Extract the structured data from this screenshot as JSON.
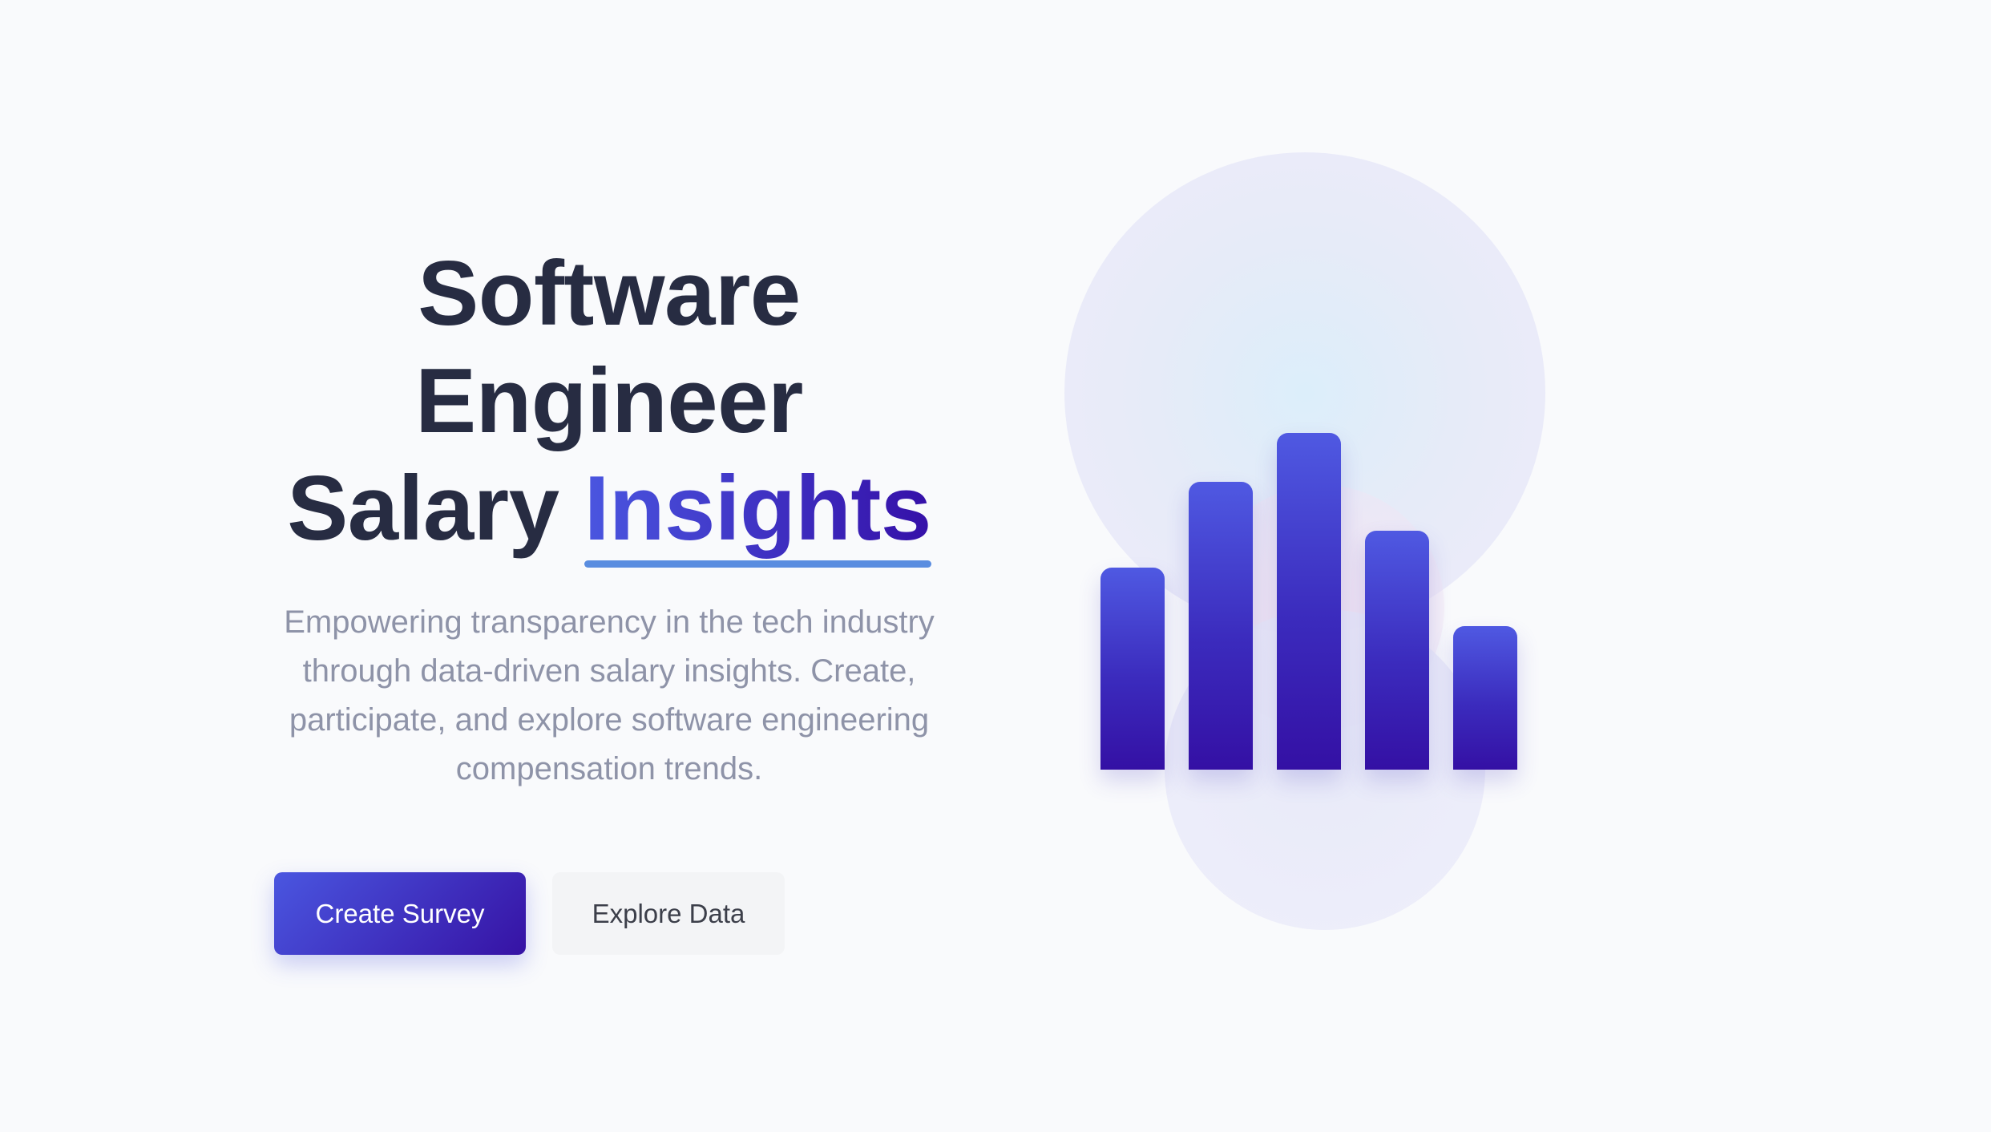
{
  "hero": {
    "title_line1": "Software",
    "title_line2": "Engineer",
    "title_line3_prefix": "Salary ",
    "title_highlight": "Insights",
    "subtitle": "Empowering transparency in the tech industry through data-driven salary insights. Create, participate, and explore software engineering compensation trends."
  },
  "buttons": {
    "primary_label": "Create Survey",
    "secondary_label": "Explore Data"
  },
  "colors": {
    "background": "#f9fafc",
    "title_text": "#272c42",
    "accent_start": "#4a56e0",
    "accent_end": "#3510a8",
    "underline": "#5a8de0",
    "subtitle_text": "#8e93a8"
  },
  "illustration": {
    "icon": "bar-chart-illustration",
    "bar_levels": [
      0.6,
      0.855,
      1.0,
      0.71,
      0.425
    ]
  }
}
